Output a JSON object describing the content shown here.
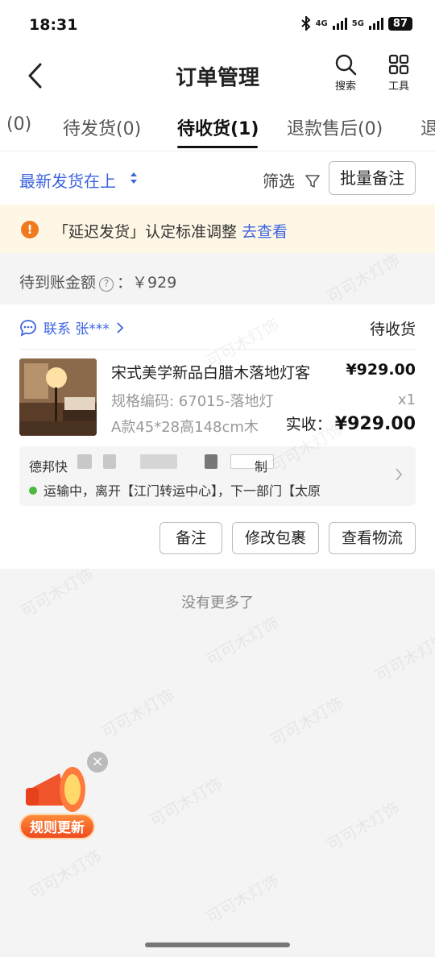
{
  "status_bar": {
    "time": "18:31",
    "network_1": "4G",
    "network_2": "5G",
    "battery": "87"
  },
  "header": {
    "title": "订单管理",
    "search_label": "搜索",
    "tools_label": "工具"
  },
  "tabs": [
    {
      "label": "(0)"
    },
    {
      "label": "待发货(0)"
    },
    {
      "label": "待收货(1)",
      "active": true
    },
    {
      "label": "退款售后(0)"
    },
    {
      "label": "退"
    }
  ],
  "sort_bar": {
    "sort_label": "最新发货在上",
    "filter_label": "筛选",
    "batch_note_label": "批量备注"
  },
  "notice": {
    "text": "「延迟发货」认定标准调整",
    "link": "去查看",
    "icon": "!"
  },
  "pending_amount": {
    "label": "待到账金额",
    "value": "：￥929"
  },
  "order": {
    "contact": "联系 张***",
    "status": "待收货",
    "product_name": "宋式美学新品白腊木落地灯客",
    "price": "¥929.00",
    "spec": "规格编码: 67015-落地灯",
    "quantity": "x1",
    "spec2": "A款45*28高148cm木",
    "paid_label": "实收：",
    "paid_value": "¥929.00",
    "logistics_carrier": "德邦快",
    "logistics_suffix": "制",
    "logistics_status": "运输中，离开【江门转运中心】，下一部门【太原",
    "actions": {
      "note": "备注",
      "edit_package": "修改包裹",
      "view_logistics": "查看物流"
    }
  },
  "footer": {
    "no_more": "没有更多了"
  },
  "watermark_text": "可可木灯饰",
  "promo": {
    "label": "规则更新",
    "close": "×"
  },
  "colors": {
    "accent": "#3b63e0",
    "warning": "#f07a1e",
    "notice_bg": "#fff7e6",
    "success": "#4cb83f"
  }
}
